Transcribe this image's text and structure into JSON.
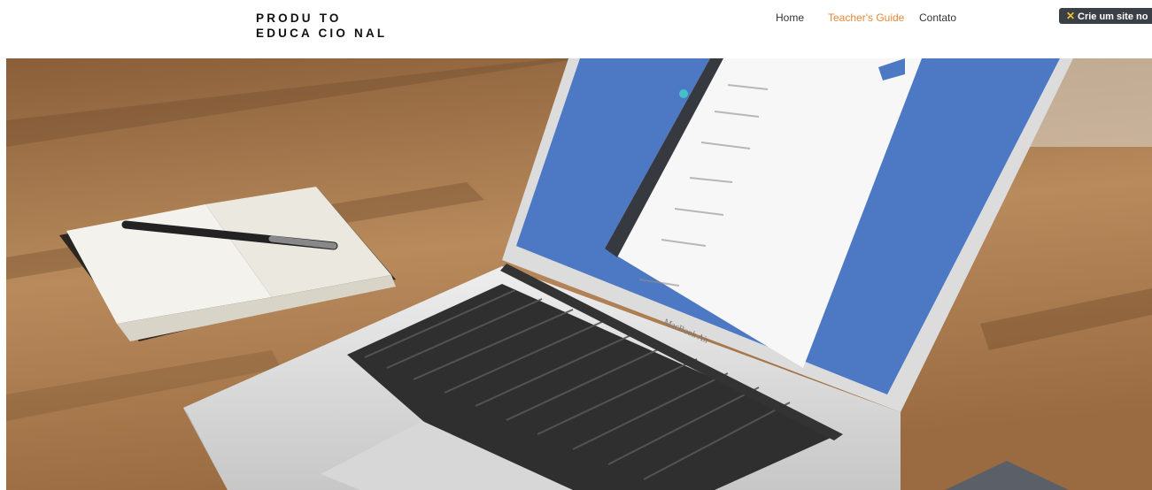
{
  "header": {
    "brand_line1": "PRODU TO",
    "brand_line2": "EDUCA CIO NAL",
    "nav": [
      {
        "label": "Home",
        "active": false
      },
      {
        "label": "Teacher's Guide",
        "active": true
      },
      {
        "label": "Contato",
        "active": false
      }
    ],
    "promo": {
      "icon": "close-icon",
      "label": "Crie um site no"
    }
  },
  "hero": {
    "image": "laptop-desk-photo",
    "laptop_brand": "MacBook Air"
  },
  "colors": {
    "accent": "#e8873a",
    "text": "#333333",
    "promo_bg": "#3b3f46",
    "wood": "#a8794c",
    "screen_blue": "#4d78c4"
  }
}
